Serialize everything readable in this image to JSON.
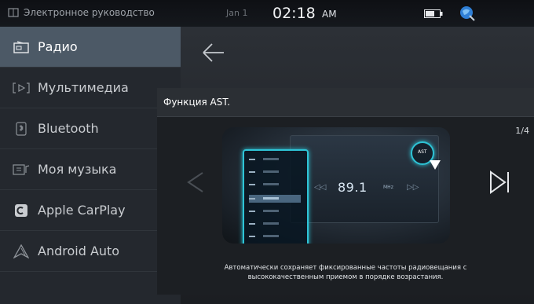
{
  "status_bar": {
    "manual_label": "Электронное руководство",
    "date": "Jan 1",
    "time": "02:18",
    "ampm": "AM"
  },
  "sidebar": {
    "items": [
      {
        "label": "Радио",
        "icon": "radio-icon",
        "active": true
      },
      {
        "label": "Мультимедиа",
        "icon": "multimedia-icon",
        "active": false
      },
      {
        "label": "Bluetooth",
        "icon": "bluetooth-phone-icon",
        "active": false
      },
      {
        "label": "Моя музыка",
        "icon": "my-music-icon",
        "active": false
      },
      {
        "label": "Apple CarPlay",
        "icon": "apple-carplay-icon",
        "active": false
      },
      {
        "label": "Android Auto",
        "icon": "android-auto-icon",
        "active": false
      }
    ]
  },
  "dialog": {
    "title": "Функция AST.",
    "page": "1/4",
    "frequency": "89.1",
    "frequency_unit": "MHz",
    "ast_label": "AST",
    "description_line1": "Автоматически сохраняет фиксированные частоты радиовещания с",
    "description_line2": "высококачественным приемом в порядке возрастания."
  },
  "colors": {
    "active_nav": "#4c5966",
    "sidebar_bg": "#24282e",
    "highlight": "#2ec4d6"
  }
}
